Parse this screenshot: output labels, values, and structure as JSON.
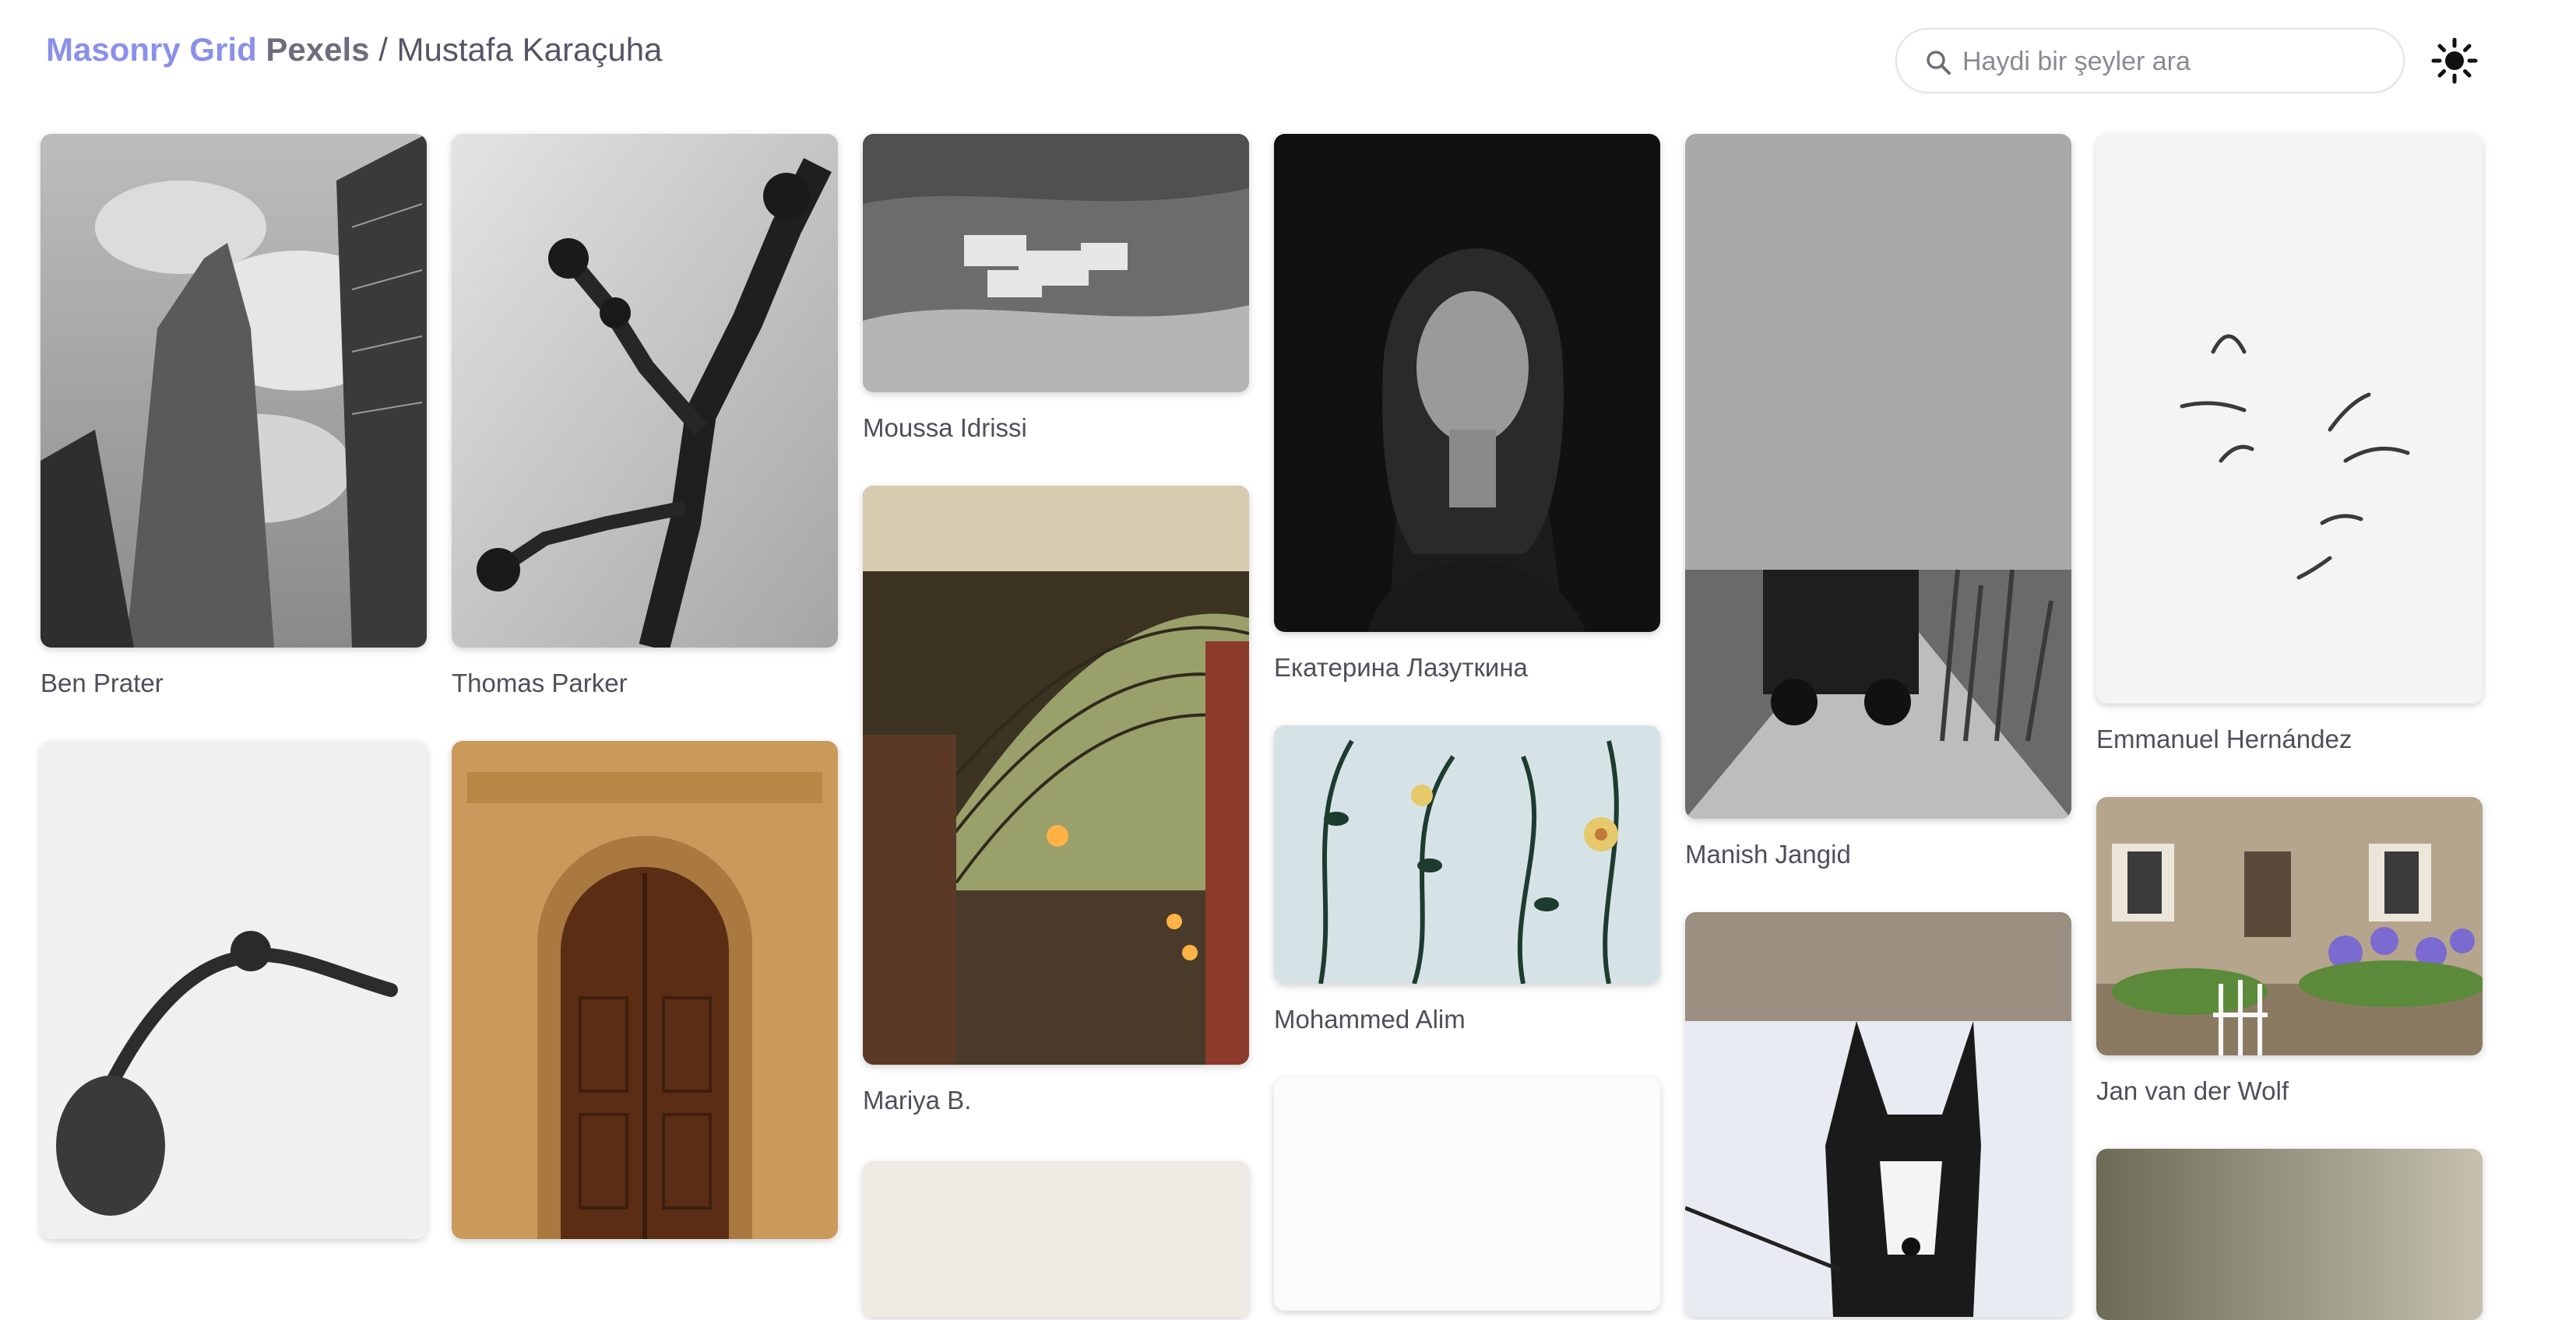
{
  "header": {
    "brand_highlight": "Masonry Grid",
    "brand_source": "Pexels",
    "separator": "/",
    "author": "Mustafa Karaçuha"
  },
  "search": {
    "placeholder": "Haydi bir şeyler ara",
    "icon": "search-icon"
  },
  "theme_toggle": {
    "icon": "sun-icon"
  },
  "colors": {
    "brand_accent": "#8b90ea",
    "text": "#4f4f5c",
    "search_border": "#e3e3e8"
  },
  "photos": [
    {
      "photographer": "Ben Prater"
    },
    {
      "photographer": "Thomas Parker"
    },
    {
      "photographer": "Moussa Idrissi"
    },
    {
      "photographer": "Екатерина Лазуткина"
    },
    {
      "photographer": "Manish Jangid"
    },
    {
      "photographer": "Emmanuel Hernández"
    },
    {
      "photographer": "Mariya B."
    },
    {
      "photographer": "Mohammed Alim"
    },
    {
      "photographer": "Jan van der Wolf"
    }
  ]
}
